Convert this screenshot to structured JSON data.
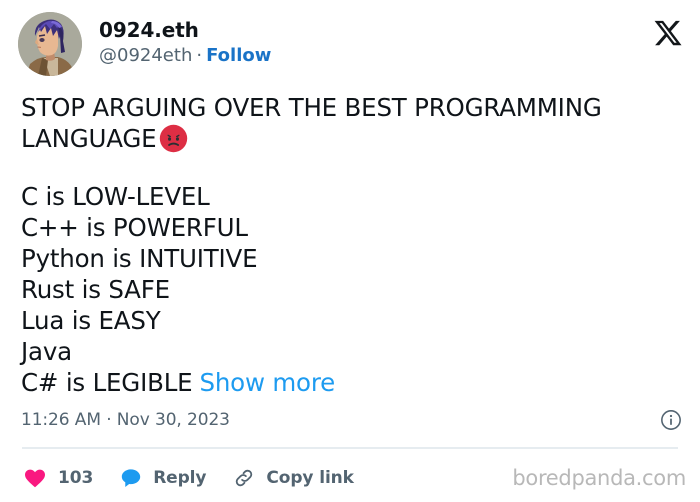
{
  "platform": "X",
  "account": {
    "display_name": "0924.eth",
    "handle": "@0924eth",
    "separator": "·",
    "follow_label": "Follow",
    "avatar_icon": "anime-character-avatar"
  },
  "logo": {
    "name": "x-logo",
    "label": "X"
  },
  "tweet": {
    "headline": "STOP ARGUING OVER THE BEST PROGRAMMING LANGUAGE",
    "headline_line_1": "STOP ARGUING OVER THE BEST PROGRAMMING",
    "headline_line_2": "LANGUAGE",
    "headline_emoji": "angry-face-emoji",
    "lines": [
      "C is LOW-LEVEL",
      "C++ is POWERFUL",
      "Python is INTUITIVE",
      "Rust is SAFE",
      "Lua is EASY",
      "Java",
      "C# is LEGIBLE"
    ],
    "show_more_label": "Show more"
  },
  "meta": {
    "time": "11:26 AM",
    "separator": "·",
    "date": "Nov 30, 2023",
    "timestamp_full": "11:26 AM · Nov 30, 2023",
    "info_icon": "info-circle-icon"
  },
  "actions": {
    "like": {
      "icon": "heart-icon",
      "count": "103",
      "color": "#f91880"
    },
    "reply": {
      "icon": "comment-bubble-icon",
      "label": "Reply",
      "color": "#1d9bf0"
    },
    "copy_link": {
      "icon": "link-chain-icon",
      "label": "Copy link",
      "color": "#536471"
    }
  },
  "watermark": "boredpanda.com",
  "colors": {
    "background": "#ffffff",
    "text_primary": "#0f1419",
    "text_secondary": "#536471",
    "link_blue": "#1d9bf0",
    "follow_blue": "#1a73c7",
    "like_pink": "#f91880",
    "divider": "#e6ecf0",
    "watermark_gray": "#b8b8b8"
  }
}
